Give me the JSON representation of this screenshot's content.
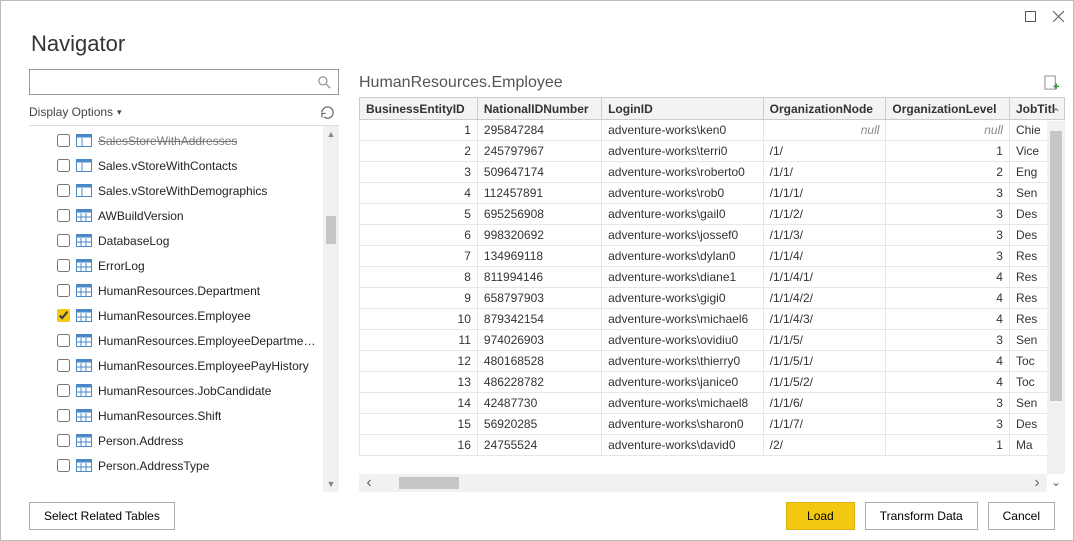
{
  "window": {
    "title": "Navigator"
  },
  "search": {
    "placeholder": ""
  },
  "display_options_label": "Display Options",
  "tree": {
    "items": [
      {
        "label": "SalesStoreWithAddresses",
        "type": "view",
        "checked": false,
        "cutoff": true
      },
      {
        "label": "Sales.vStoreWithContacts",
        "type": "view",
        "checked": false
      },
      {
        "label": "Sales.vStoreWithDemographics",
        "type": "view",
        "checked": false
      },
      {
        "label": "AWBuildVersion",
        "type": "table",
        "checked": false
      },
      {
        "label": "DatabaseLog",
        "type": "table",
        "checked": false
      },
      {
        "label": "ErrorLog",
        "type": "table",
        "checked": false
      },
      {
        "label": "HumanResources.Department",
        "type": "table",
        "checked": false
      },
      {
        "label": "HumanResources.Employee",
        "type": "table",
        "checked": true
      },
      {
        "label": "HumanResources.EmployeeDepartmen...",
        "type": "table",
        "checked": false
      },
      {
        "label": "HumanResources.EmployeePayHistory",
        "type": "table",
        "checked": false
      },
      {
        "label": "HumanResources.JobCandidate",
        "type": "table",
        "checked": false
      },
      {
        "label": "HumanResources.Shift",
        "type": "table",
        "checked": false
      },
      {
        "label": "Person.Address",
        "type": "table",
        "checked": false
      },
      {
        "label": "Person.AddressType",
        "type": "table",
        "checked": false
      }
    ]
  },
  "preview": {
    "title": "HumanResources.Employee",
    "columns": [
      "BusinessEntityID",
      "NationalIDNumber",
      "LoginID",
      "OrganizationNode",
      "OrganizationLevel",
      "JobTitl"
    ],
    "rows": [
      {
        "id": "1",
        "nid": "295847284",
        "login": "adventure-works\\ken0",
        "org": "null",
        "lvl": "null",
        "job": "Chie"
      },
      {
        "id": "2",
        "nid": "245797967",
        "login": "adventure-works\\terri0",
        "org": "/1/",
        "lvl": "1",
        "job": "Vice"
      },
      {
        "id": "3",
        "nid": "509647174",
        "login": "adventure-works\\roberto0",
        "org": "/1/1/",
        "lvl": "2",
        "job": "Eng"
      },
      {
        "id": "4",
        "nid": "112457891",
        "login": "adventure-works\\rob0",
        "org": "/1/1/1/",
        "lvl": "3",
        "job": "Sen"
      },
      {
        "id": "5",
        "nid": "695256908",
        "login": "adventure-works\\gail0",
        "org": "/1/1/2/",
        "lvl": "3",
        "job": "Des"
      },
      {
        "id": "6",
        "nid": "998320692",
        "login": "adventure-works\\jossef0",
        "org": "/1/1/3/",
        "lvl": "3",
        "job": "Des"
      },
      {
        "id": "7",
        "nid": "134969118",
        "login": "adventure-works\\dylan0",
        "org": "/1/1/4/",
        "lvl": "3",
        "job": "Res"
      },
      {
        "id": "8",
        "nid": "811994146",
        "login": "adventure-works\\diane1",
        "org": "/1/1/4/1/",
        "lvl": "4",
        "job": "Res"
      },
      {
        "id": "9",
        "nid": "658797903",
        "login": "adventure-works\\gigi0",
        "org": "/1/1/4/2/",
        "lvl": "4",
        "job": "Res"
      },
      {
        "id": "10",
        "nid": "879342154",
        "login": "adventure-works\\michael6",
        "org": "/1/1/4/3/",
        "lvl": "4",
        "job": "Res"
      },
      {
        "id": "11",
        "nid": "974026903",
        "login": "adventure-works\\ovidiu0",
        "org": "/1/1/5/",
        "lvl": "3",
        "job": "Sen"
      },
      {
        "id": "12",
        "nid": "480168528",
        "login": "adventure-works\\thierry0",
        "org": "/1/1/5/1/",
        "lvl": "4",
        "job": "Toc"
      },
      {
        "id": "13",
        "nid": "486228782",
        "login": "adventure-works\\janice0",
        "org": "/1/1/5/2/",
        "lvl": "4",
        "job": "Toc"
      },
      {
        "id": "14",
        "nid": "42487730",
        "login": "adventure-works\\michael8",
        "org": "/1/1/6/",
        "lvl": "3",
        "job": "Sen"
      },
      {
        "id": "15",
        "nid": "56920285",
        "login": "adventure-works\\sharon0",
        "org": "/1/1/7/",
        "lvl": "3",
        "job": "Des"
      },
      {
        "id": "16",
        "nid": "24755524",
        "login": "adventure-works\\david0",
        "org": "/2/",
        "lvl": "1",
        "job": "Ma"
      }
    ]
  },
  "footer": {
    "select_related": "Select Related Tables",
    "load": "Load",
    "transform": "Transform Data",
    "cancel": "Cancel"
  }
}
